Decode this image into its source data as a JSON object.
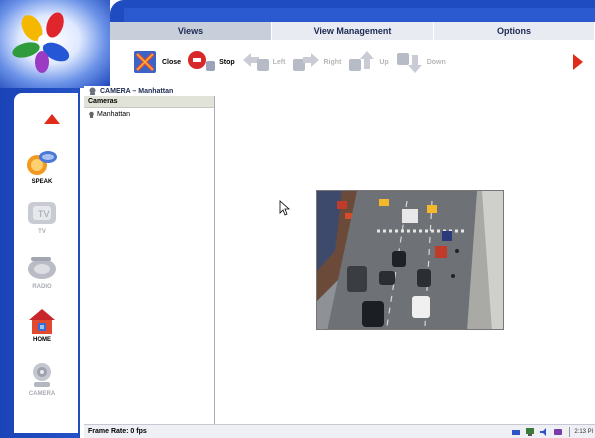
{
  "tabs": [
    {
      "label": "Views",
      "active": true
    },
    {
      "label": "View Management",
      "active": false
    },
    {
      "label": "Options",
      "active": false
    }
  ],
  "toolbar": {
    "close_label": "Close",
    "stop_label": "Stop",
    "left_label": "Left",
    "right_label": "Right",
    "up_label": "Up",
    "down_label": "Down"
  },
  "sidebar": {
    "items": [
      {
        "label": "SPEAK",
        "icon": "speak-icon"
      },
      {
        "label": "TV",
        "icon": "tv-icon"
      },
      {
        "label": "RADIO",
        "icon": "radio-icon"
      },
      {
        "label": "HOME",
        "icon": "home-icon"
      },
      {
        "label": "CAMERA",
        "icon": "camera-icon"
      }
    ]
  },
  "content": {
    "header": "CAMERA – Manhattan",
    "cameras_header": "Cameras",
    "cameras": [
      "Manhattan"
    ]
  },
  "status": {
    "frame_rate": "Frame Rate: 0 fps",
    "time": "2:13 Pl"
  },
  "colors": {
    "accent_blue": "#1f4cc0",
    "tab_bg": "#e6e9f2",
    "active_tab": "#c9cedb"
  }
}
